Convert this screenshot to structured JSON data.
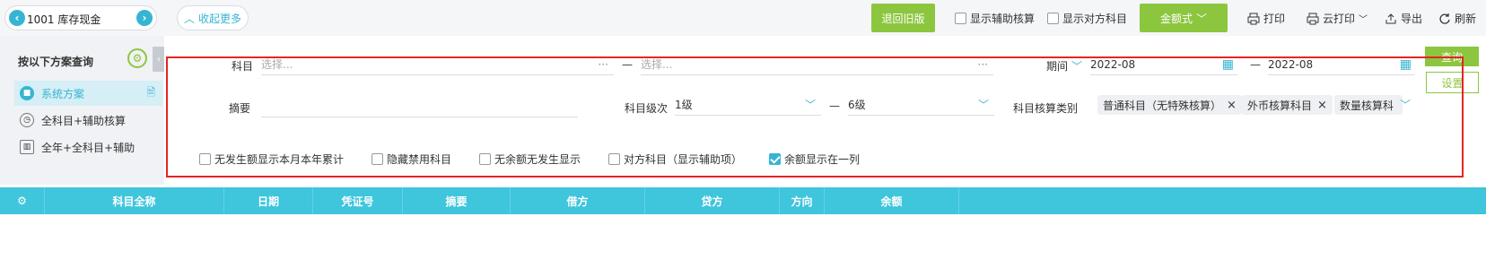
{
  "toolbar": {
    "account_value": "1001 库存现金",
    "collapse_label": "收起更多",
    "back_old_label": "退回旧版",
    "show_aux_label": "显示辅助核算",
    "show_counter_label": "显示对方科目",
    "amount_format_label": "金额式",
    "print_label": "打印",
    "cloud_print_label": "云打印",
    "export_label": "导出",
    "refresh_label": "刷新"
  },
  "left_panel": {
    "title": "按以下方案查询",
    "items": [
      {
        "label": "系统方案",
        "active": true
      },
      {
        "label": "全科目+辅助核算",
        "active": false
      },
      {
        "label": "全年+全科目+辅助",
        "active": false
      }
    ]
  },
  "filter": {
    "subject_label": "科目",
    "subject_from_placeholder": "选择...",
    "subject_to_placeholder": "选择...",
    "dash": "—",
    "period_label": "期间",
    "period_from": "2022-08",
    "period_to": "2022-08",
    "summary_label": "摘要",
    "level_label": "科目级次",
    "level_from": "1级",
    "level_to": "6级",
    "calc_type_label": "科目核算类别",
    "tags": [
      "普通科目（无特殊核算）",
      "外币核算科目",
      "数量核算科"
    ],
    "query_label": "查询",
    "settings_label": "设置",
    "options": [
      {
        "label": "无发生额显示本月本年累计",
        "checked": false
      },
      {
        "label": "隐藏禁用科目",
        "checked": false
      },
      {
        "label": "无余额无发生显示",
        "checked": false
      },
      {
        "label": "对方科目（显示辅助项）",
        "checked": false
      },
      {
        "label": "余额显示在一列",
        "checked": true
      }
    ]
  },
  "table": {
    "columns": [
      "科目全称",
      "日期",
      "凭证号",
      "摘要",
      "借方",
      "贷方",
      "方向",
      "余额"
    ]
  },
  "colors": {
    "accent": "#36b5d3",
    "green": "#8cc63f",
    "header": "#3fc5dc",
    "highlight": "#e52521"
  }
}
